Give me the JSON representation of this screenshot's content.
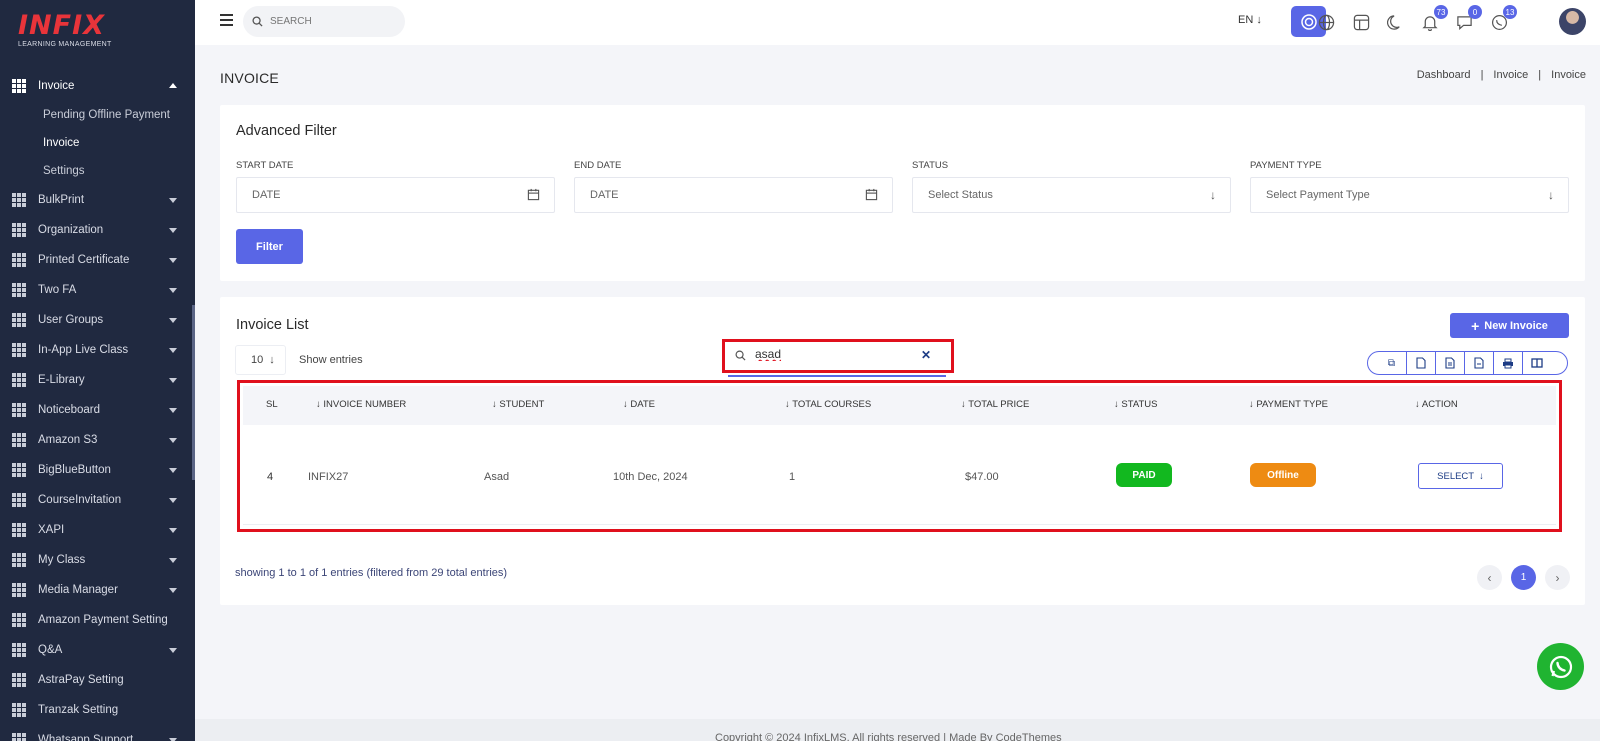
{
  "brand": {
    "logo_text": "INFIX",
    "logo_sub": "LEARNING MANAGEMENT"
  },
  "sidebar": {
    "open_item": "Invoice",
    "sub_items": [
      {
        "label": "Pending Offline Payment",
        "active": false
      },
      {
        "label": "Invoice",
        "active": true
      },
      {
        "label": "Settings",
        "active": false
      }
    ],
    "items": [
      "BulkPrint",
      "Organization",
      "Printed Certificate",
      "Two FA",
      "User Groups",
      "In-App Live Class",
      "E-Library",
      "Noticeboard",
      "Amazon S3",
      "BigBlueButton",
      "CourseInvitation",
      "XAPI",
      "My Class",
      "Media Manager",
      "Amazon Payment Setting",
      "Q&A",
      "AstraPay Setting",
      "Tranzak Setting",
      "Whatsapp Support"
    ]
  },
  "topbar": {
    "search_placeholder": "SEARCH",
    "language": "EN",
    "notification_count": "73",
    "message_count": "0",
    "chat_count": "13"
  },
  "page": {
    "title": "INVOICE",
    "breadcrumb": [
      "Dashboard",
      "Invoice",
      "Invoice"
    ]
  },
  "filter": {
    "title": "Advanced Filter",
    "start_date_label": "START DATE",
    "start_date_placeholder": "DATE",
    "end_date_label": "END DATE",
    "end_date_placeholder": "DATE",
    "status_label": "STATUS",
    "status_value": "Select Status",
    "payment_type_label": "PAYMENT TYPE",
    "payment_type_value": "Select Payment Type",
    "button": "Filter"
  },
  "invoice_list": {
    "title": "Invoice List",
    "new_button": "New Invoice",
    "page_length": "10",
    "show_entries": "Show entries",
    "search_value": "asad",
    "columns": [
      "SL",
      "INVOICE NUMBER",
      "STUDENT",
      "DATE",
      "TOTAL COURSES",
      "TOTAL PRICE",
      "STATUS",
      "PAYMENT TYPE",
      "ACTION"
    ],
    "rows": [
      {
        "sl": "4",
        "invoice_number": "INFIX27",
        "student": "Asad",
        "date": "10th Dec, 2024",
        "total_courses": "1",
        "total_price": "$47.00",
        "status": "PAID",
        "payment_type": "Offline",
        "action": "SELECT"
      }
    ],
    "info": "showing 1 to 1 of 1 entries (filtered from 29 total entries)",
    "current_page": "1"
  },
  "colors": {
    "accent": "#5966e6",
    "sidebar_bg": "#202940",
    "paid": "#12b81f",
    "offline": "#ee8b12",
    "highlight": "#e0101d",
    "whatsapp": "#20b431"
  },
  "footer": {
    "text": "Copyright © 2024 InfixLMS. All rights reserved | Made By CodeThemes"
  }
}
